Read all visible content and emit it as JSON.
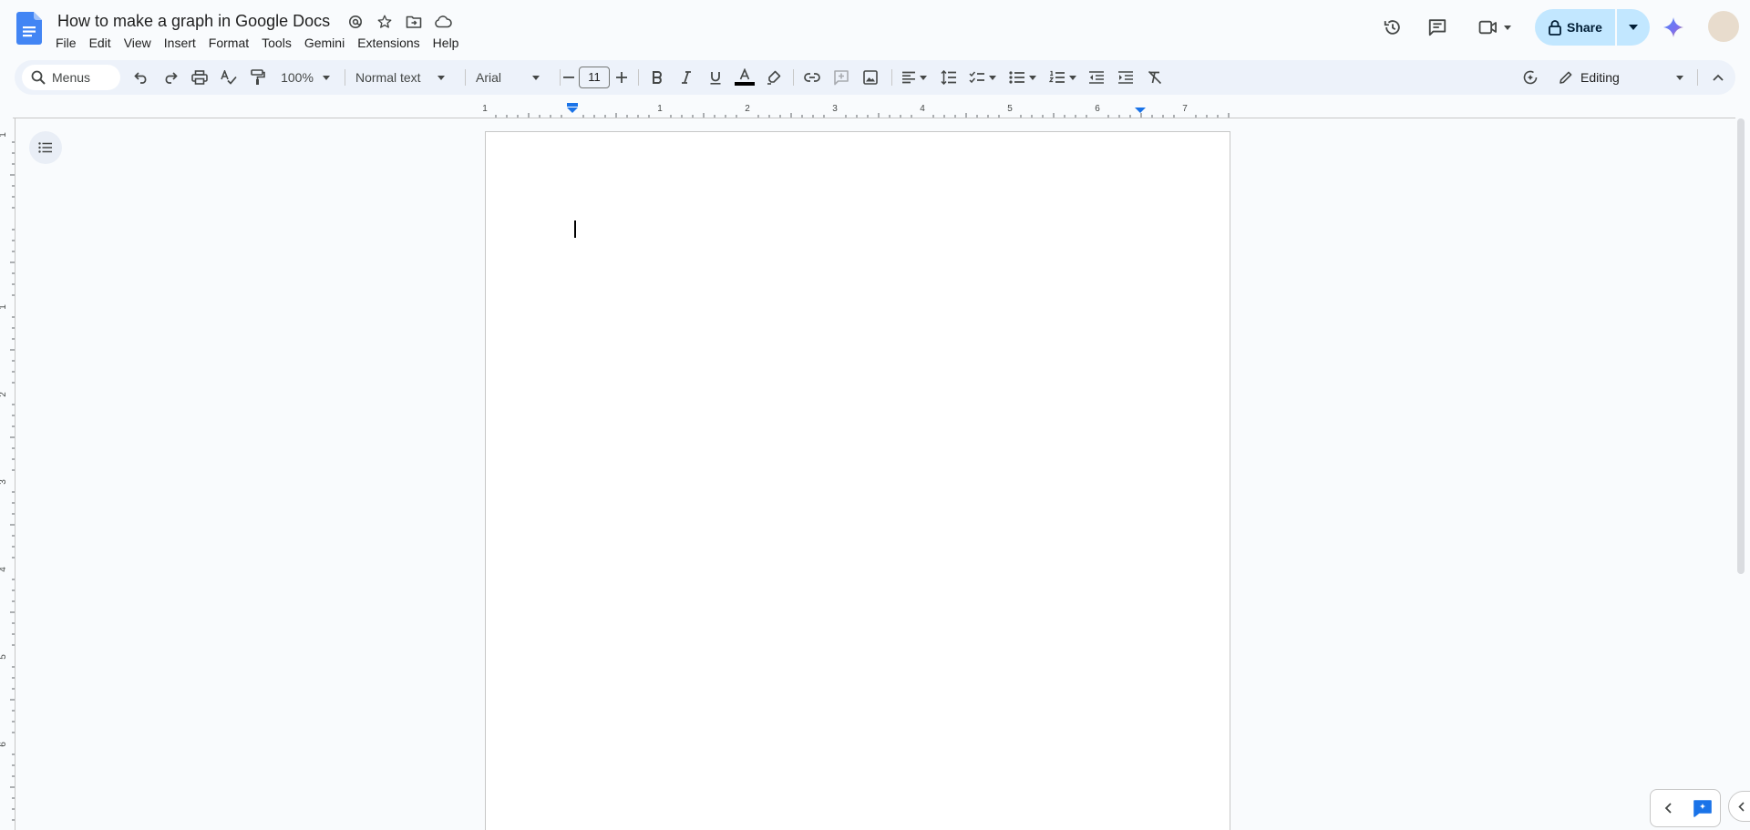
{
  "app": {
    "document_title": "How to make a graph in Google Docs"
  },
  "menubar": {
    "items": [
      "File",
      "Edit",
      "View",
      "Insert",
      "Format",
      "Tools",
      "Gemini",
      "Extensions",
      "Help"
    ]
  },
  "header": {
    "share_label": "Share"
  },
  "toolbar": {
    "search_label": "Menus",
    "zoom": "100%",
    "style": "Normal text",
    "font": "Arial",
    "font_size": "11",
    "mode": "Editing"
  },
  "ruler": {
    "top_labels": [
      "1",
      "1",
      "2",
      "3",
      "4",
      "5",
      "6",
      "7"
    ],
    "left_labels": [
      "1",
      "1",
      "2",
      "3",
      "4",
      "5",
      "6"
    ]
  },
  "colors": {
    "accent": "#1a73e8",
    "share_bg": "#c2e7ff",
    "toolbar_bg": "#edf2fa",
    "text_color_bar": "#000000"
  },
  "icons": {
    "logo": "google-docs-logo",
    "title": [
      "mention-icon",
      "star-icon",
      "move-folder-icon",
      "cloud-saved-icon"
    ],
    "header_right": [
      "history-icon",
      "comments-icon",
      "meet-icon",
      "lock-icon",
      "gemini-icon"
    ]
  }
}
